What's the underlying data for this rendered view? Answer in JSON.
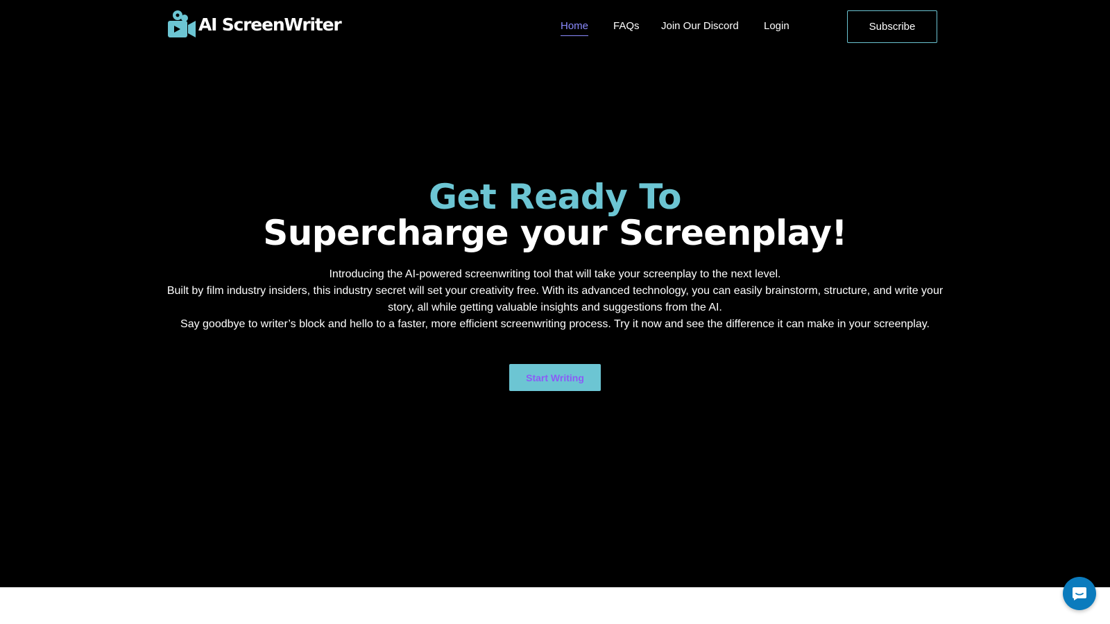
{
  "brand": {
    "name": "AI ScreenWriter",
    "logo_icon": "film-camera-icon",
    "accent_color": "#6cc5d3"
  },
  "nav": {
    "items": [
      {
        "label": "Home",
        "active": true
      },
      {
        "label": "FAQs",
        "active": false
      },
      {
        "label": "Join Our Discord",
        "active": false
      },
      {
        "label": "Login",
        "active": false
      }
    ],
    "subscribe_label": "Subscribe"
  },
  "hero": {
    "headline_line1": "Get Ready To",
    "headline_line2": "Supercharge your Screenplay!",
    "paragraphs": [
      "Introducing the AI-powered screenwriting tool that will take your screenplay to the next level.",
      "Built by film industry insiders, this industry secret will set your creativity free. With its advanced technology, you can easily brainstorm, structure, and write your story, all while getting valuable insights and suggestions from the AI.",
      "Say goodbye to writer’s block and hello to a faster, more efficient screenwriting process. Try it now and see the difference it can make in your screenplay."
    ],
    "cta_label": "Start Writing"
  },
  "chat": {
    "icon": "chat-bubble-icon"
  }
}
